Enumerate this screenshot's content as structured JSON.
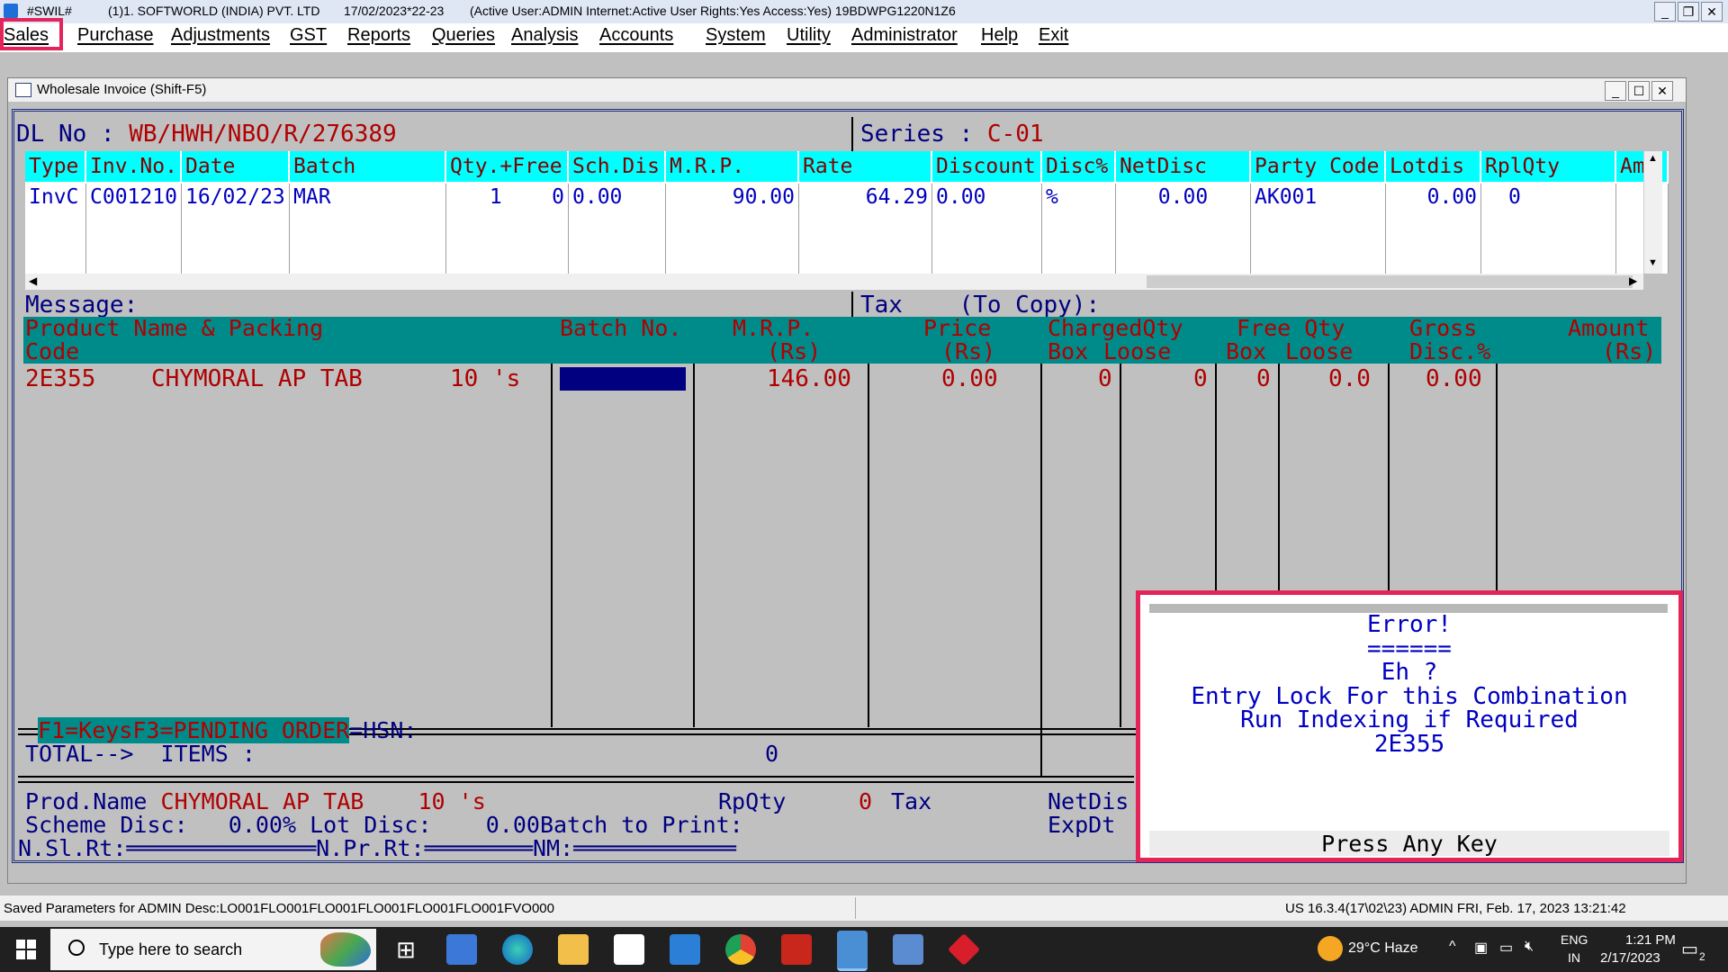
{
  "window": {
    "app_name": "#SWIL#",
    "company": "(1)1. SOFTWORLD (INDIA) PVT. LTD",
    "date_fy": "17/02/2023*22-23",
    "user_info": "(Active User:ADMIN Internet:Active  User Rights:Yes Access:Yes) 19BDWPG1220N1Z6"
  },
  "menu": [
    "Sales",
    "Purchase",
    "Adjustments",
    "GST",
    "Reports",
    "Queries",
    "Analysis",
    "Accounts",
    "System",
    "Utility",
    "Administrator",
    "Help",
    "Exit"
  ],
  "invoice_window": {
    "title": "Wholesale Invoice (Shift-F5)",
    "dl_label": "DL No   :",
    "dl_value": "WB/HWH/NBO/R/276389",
    "series_label": "Series     :",
    "series_value": "C-01"
  },
  "history_grid": {
    "columns": [
      "Type",
      "Inv.No.",
      "Date",
      "Batch",
      "Qty.+Free",
      "Sch.Dis",
      "M.R.P.",
      "Rate",
      "Discount",
      "Disc%",
      "NetDisc",
      "Party Code",
      "Lotdis",
      "RplQty",
      "Am"
    ],
    "rows": [
      [
        "InvC",
        "C001210",
        "16/02/23",
        "MAR",
        "1    0",
        "0.00",
        "90.00",
        "64.29",
        "0.00",
        "%",
        "0.00",
        "AK001",
        "0.00",
        "0",
        ""
      ]
    ]
  },
  "message": {
    "label": "Message:",
    "tax_label": "Tax    (To Copy):"
  },
  "item_grid": {
    "headers": {
      "product_top": "Product Name & Packing",
      "product_bottom": "Code",
      "batch": "Batch No.",
      "mrp_top": "M.R.P.",
      "mrp_bottom": "(Rs)",
      "price_top": "Price",
      "price_bottom": "(Rs)",
      "charged_top": "ChargedQty",
      "charged_box": "Box",
      "charged_loose": "Loose",
      "free_top": "Free Qty",
      "free_box": "Box",
      "free_loose": "Loose",
      "gross_top": "Gross",
      "gross_bottom": "Disc.%",
      "amount_top": "Amount",
      "amount_bottom": "(Rs)"
    },
    "row": {
      "code": "2E355",
      "name": "CHYMORAL AP TAB",
      "pack": "10 's",
      "mrp": "146.00",
      "price": "0.00",
      "charged_box": "0",
      "charged_loose": "0",
      "free_box": "0",
      "free_loose": "0.0",
      "gross_disc": "0.00"
    }
  },
  "footer": {
    "f1": "F1=Keys",
    "f3": "F3=PENDING ORDER",
    "hsn": "=HSN:",
    "total_label": "TOTAL-->  ITEMS :",
    "total_items": "0",
    "prod_label": "Prod.Name",
    "prod_value": "CHYMORAL AP TAB    10 's",
    "rpqty_label": "RpQty",
    "rpqty_value": "0",
    "tax_label": "Tax",
    "netdis_label": "NetDis",
    "scheme_line": "Scheme Disc:   0.00% Lot Disc:    0.00",
    "batch_print": "Batch to Print:",
    "expdt": "ExpDt",
    "nsl": "N.Sl.Rt:",
    "npr": "N.Pr.Rt:",
    "nm": "NM:"
  },
  "error_dialog": {
    "lines": [
      "Error!",
      "======",
      "Eh ?",
      "Entry Lock For this Combination",
      "Run Indexing if Required",
      "2E355"
    ],
    "footer": "Press Any Key"
  },
  "statusbar": {
    "left": "Saved Parameters for ADMIN Desc:LO001FLO001FLO001FLO001FLO001FLO001FVO000",
    "right": "US 16.3.4(17\\02\\23) ADMIN  FRI, Feb. 17, 2023  13:21:42"
  },
  "taskbar": {
    "search_placeholder": "Type here to search",
    "weather": "29°C  Haze",
    "lang_top": "ENG",
    "lang_bottom": "IN",
    "time": "1:21 PM",
    "date": "2/17/2023",
    "notif_count": "2"
  }
}
